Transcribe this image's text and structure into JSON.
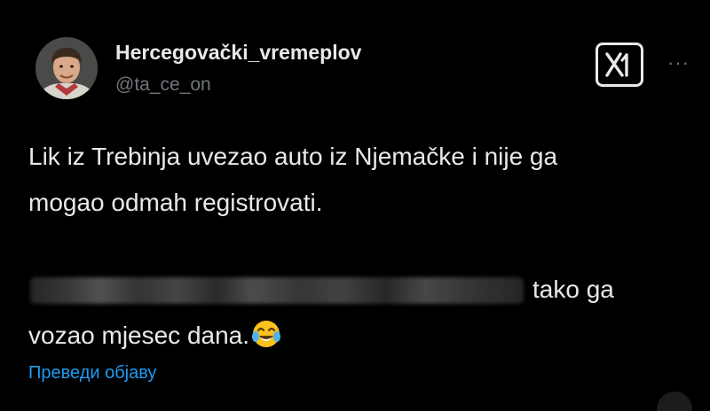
{
  "author": {
    "display_name": "Hercegovački_vremeplov",
    "handle": "@ta_ce_on",
    "avatar_icon": "profile-photo"
  },
  "header": {
    "badge_label": "X",
    "badge_icon": "x-logo-icon",
    "more_icon": "more-horizontal-icon",
    "more_label": "···"
  },
  "tweet": {
    "line1": "Lik iz Trebinja uvezao auto iz Njemačke i nije ga",
    "line2": "mogao odmah registrovati.",
    "line3_visible": "tako ga",
    "line4": "vozao mjesec dana.",
    "emoji": "face-with-tears-of-joy",
    "redacted_segment": true
  },
  "translate_label": "Преведи објаву",
  "colors": {
    "background": "#000000",
    "text_primary": "#e7e9ea",
    "text_secondary": "#71767b",
    "link": "#1d9bf0"
  }
}
